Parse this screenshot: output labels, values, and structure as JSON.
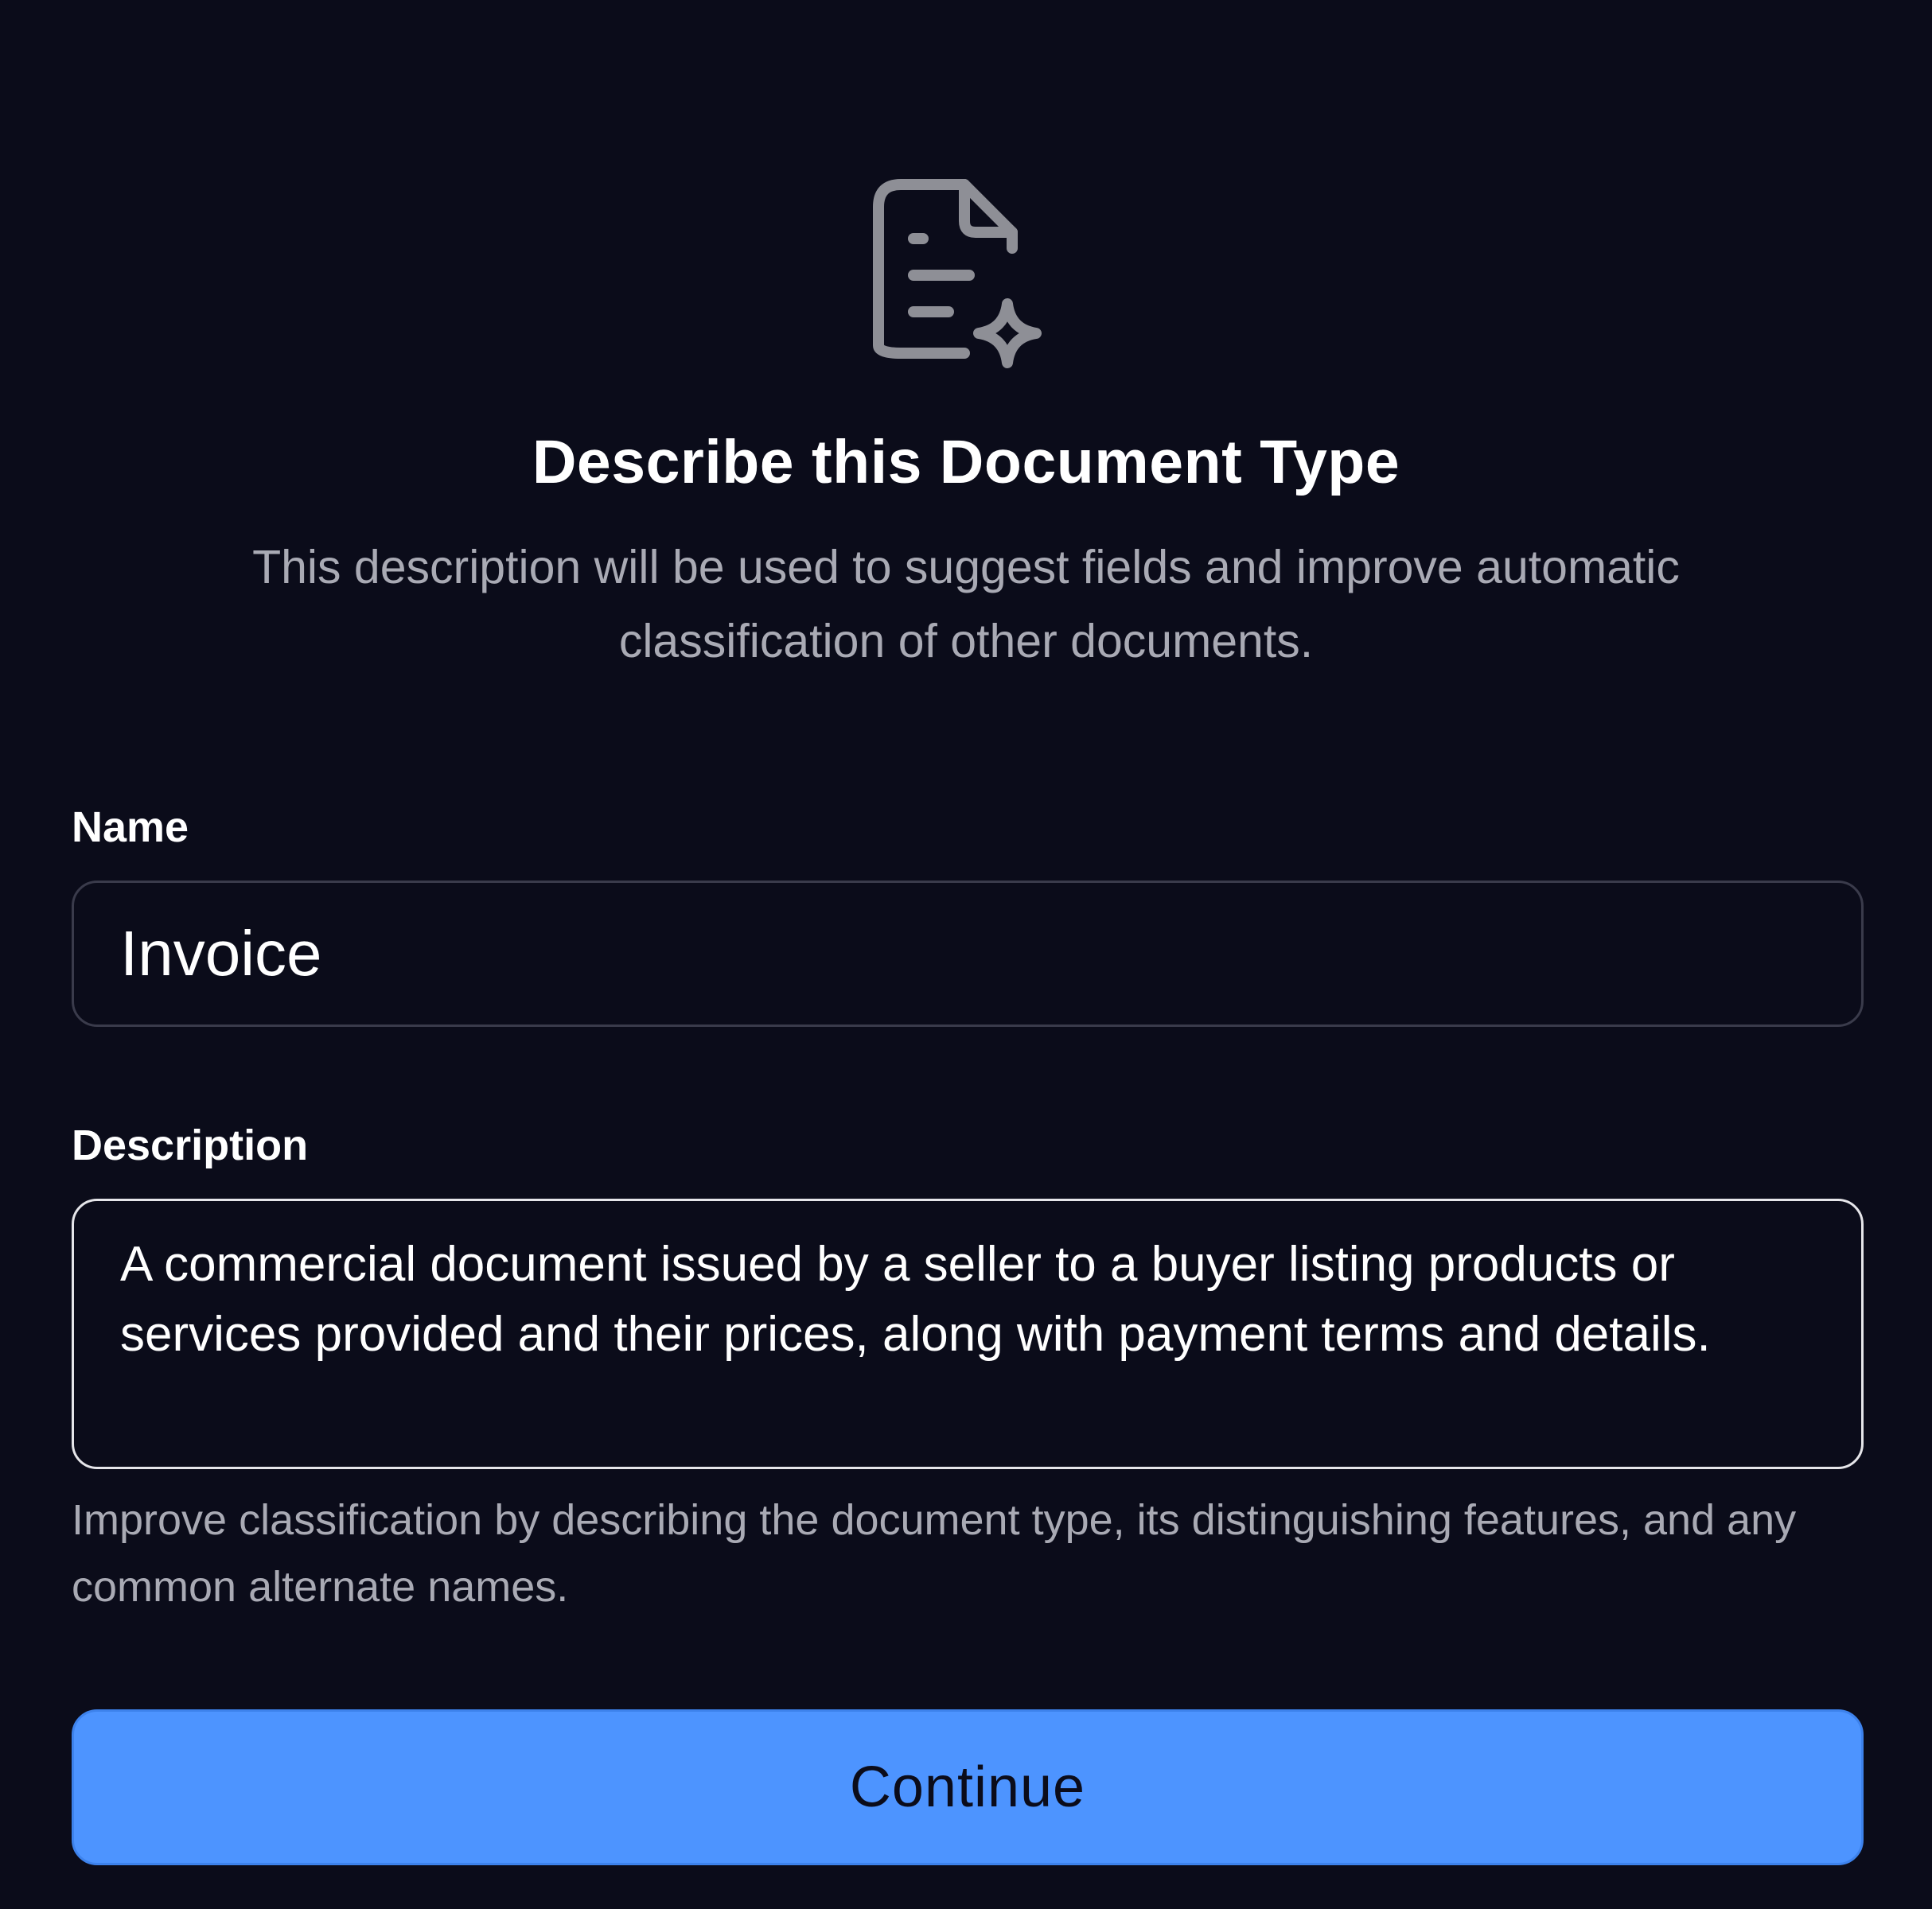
{
  "header": {
    "icon": "document-sparkle-icon",
    "title": "Describe this Document Type",
    "subtitle": "This description will be used to suggest fields and improve automatic classification of other documents."
  },
  "form": {
    "name": {
      "label": "Name",
      "value": "Invoice"
    },
    "description": {
      "label": "Description",
      "value": "A commercial document issued by a seller to a buyer listing products or services provided and their prices, along with payment terms and details.",
      "help": "Improve classification by describing the document type, its distinguishing features, and any common alternate names."
    },
    "continue_label": "Continue"
  },
  "colors": {
    "background": "#0b0c1a",
    "accent": "#4d94ff",
    "muted_text": "#a9aab4",
    "icon": "#8e8f96"
  }
}
